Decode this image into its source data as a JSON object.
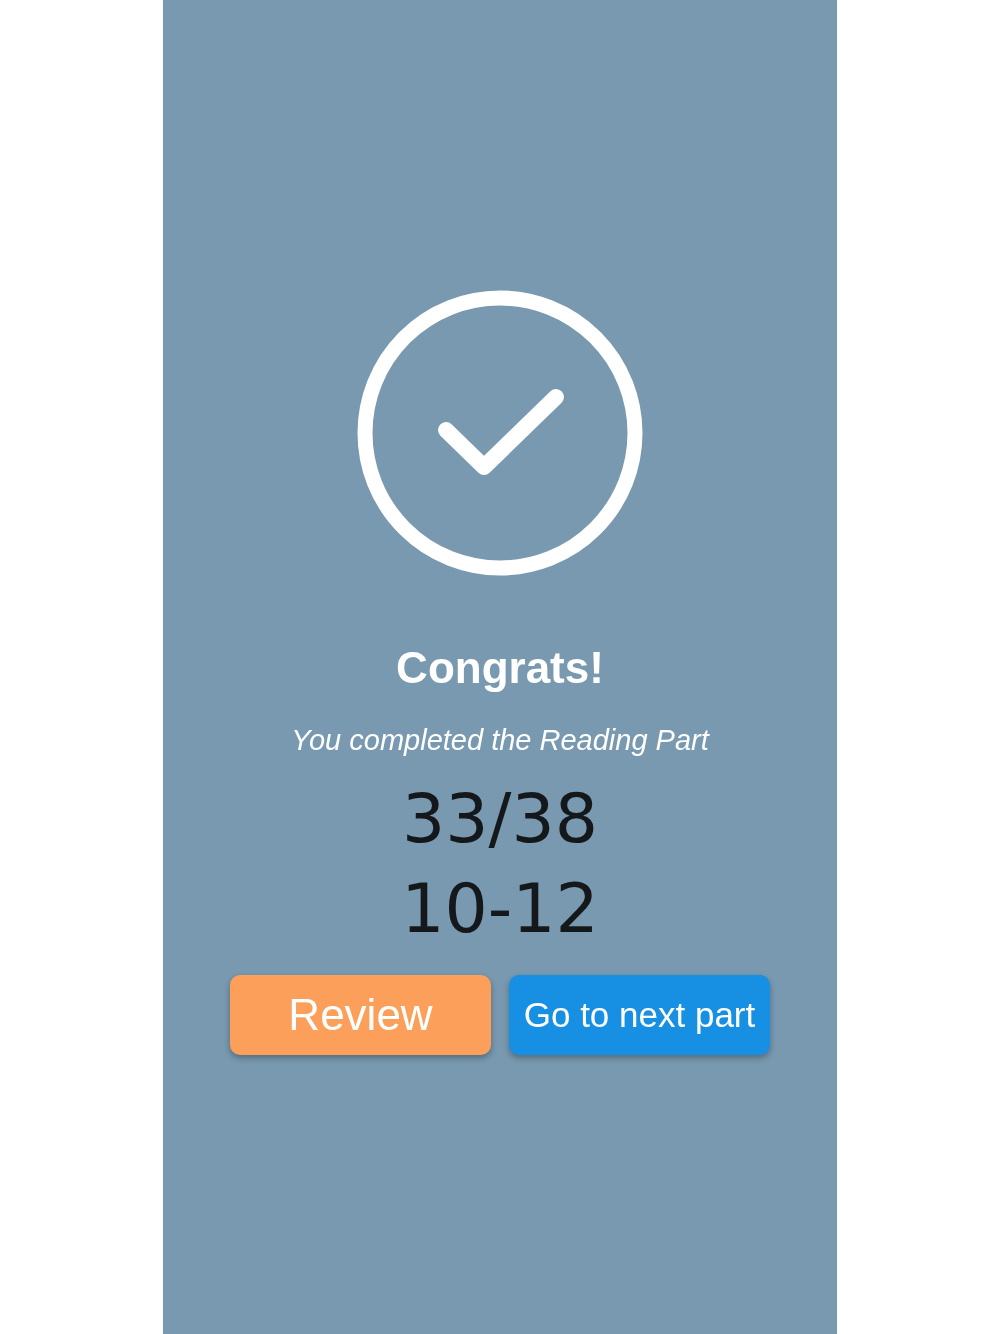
{
  "result": {
    "title": "Congrats!",
    "subtitle": "You completed the Reading Part",
    "score": "33/38",
    "band": "10-12"
  },
  "buttons": [
    {
      "label": "Review",
      "kind": "secondary"
    },
    {
      "label": "Go to next part",
      "kind": "primary"
    }
  ]
}
